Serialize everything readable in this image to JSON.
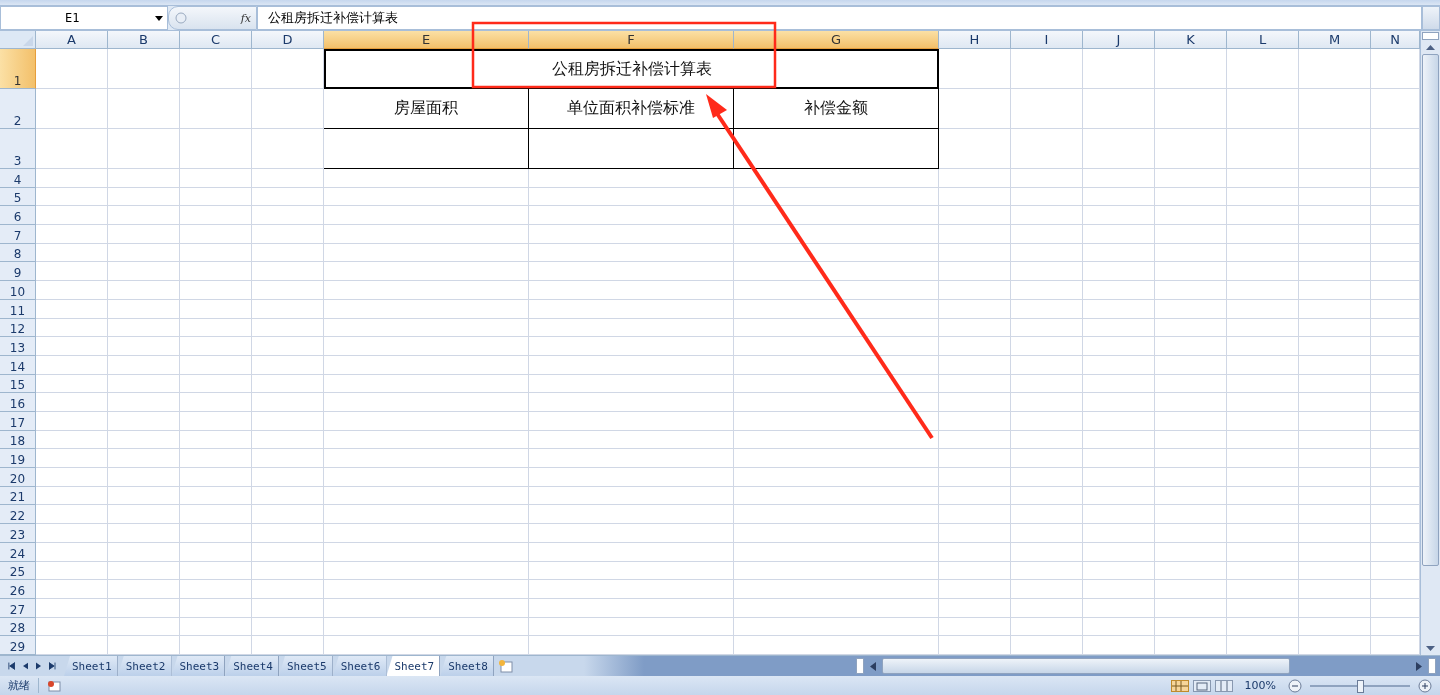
{
  "name_box": {
    "value": "E1"
  },
  "formula_bar": {
    "fx": "fx",
    "value": "公租房拆迁补偿计算表"
  },
  "columns": [
    {
      "label": "A",
      "selected": false
    },
    {
      "label": "B",
      "selected": false
    },
    {
      "label": "C",
      "selected": false
    },
    {
      "label": "D",
      "selected": false
    },
    {
      "label": "E",
      "selected": true
    },
    {
      "label": "F",
      "selected": true
    },
    {
      "label": "G",
      "selected": true
    },
    {
      "label": "H",
      "selected": false
    },
    {
      "label": "I",
      "selected": false
    },
    {
      "label": "J",
      "selected": false
    },
    {
      "label": "K",
      "selected": false
    },
    {
      "label": "L",
      "selected": false
    },
    {
      "label": "M",
      "selected": false
    },
    {
      "label": "N",
      "selected": false
    }
  ],
  "rows": [
    {
      "label": "1",
      "selected": true
    },
    {
      "label": "2",
      "selected": false
    },
    {
      "label": "3",
      "selected": false
    },
    {
      "label": "4",
      "selected": false
    },
    {
      "label": "5",
      "selected": false
    },
    {
      "label": "6",
      "selected": false
    },
    {
      "label": "7",
      "selected": false
    },
    {
      "label": "8",
      "selected": false
    },
    {
      "label": "9",
      "selected": false
    },
    {
      "label": "10",
      "selected": false
    },
    {
      "label": "11",
      "selected": false
    },
    {
      "label": "12",
      "selected": false
    },
    {
      "label": "13",
      "selected": false
    },
    {
      "label": "14",
      "selected": false
    },
    {
      "label": "15",
      "selected": false
    },
    {
      "label": "16",
      "selected": false
    },
    {
      "label": "17",
      "selected": false
    },
    {
      "label": "18",
      "selected": false
    },
    {
      "label": "19",
      "selected": false
    },
    {
      "label": "20",
      "selected": false
    },
    {
      "label": "21",
      "selected": false
    },
    {
      "label": "22",
      "selected": false
    },
    {
      "label": "23",
      "selected": false
    },
    {
      "label": "24",
      "selected": false
    },
    {
      "label": "25",
      "selected": false
    },
    {
      "label": "26",
      "selected": false
    },
    {
      "label": "27",
      "selected": false
    },
    {
      "label": "28",
      "selected": false
    },
    {
      "label": "29",
      "selected": false
    }
  ],
  "table": {
    "title": "公租房拆迁补偿计算表",
    "headers": [
      "房屋面积",
      "单位面积补偿标准",
      "补偿金额"
    ]
  },
  "sheet_tabs": [
    {
      "label": "Sheet1",
      "selected": false
    },
    {
      "label": "Sheet2",
      "selected": false
    },
    {
      "label": "Sheet3",
      "selected": false
    },
    {
      "label": "Sheet4",
      "selected": false
    },
    {
      "label": "Sheet5",
      "selected": false
    },
    {
      "label": "Sheet6",
      "selected": false
    },
    {
      "label": "Sheet7",
      "selected": true
    },
    {
      "label": "Sheet8",
      "selected": false
    }
  ],
  "status_bar": {
    "text": "就绪",
    "zoom": "100%",
    "zoom_slider": {
      "level": 0.5
    }
  }
}
